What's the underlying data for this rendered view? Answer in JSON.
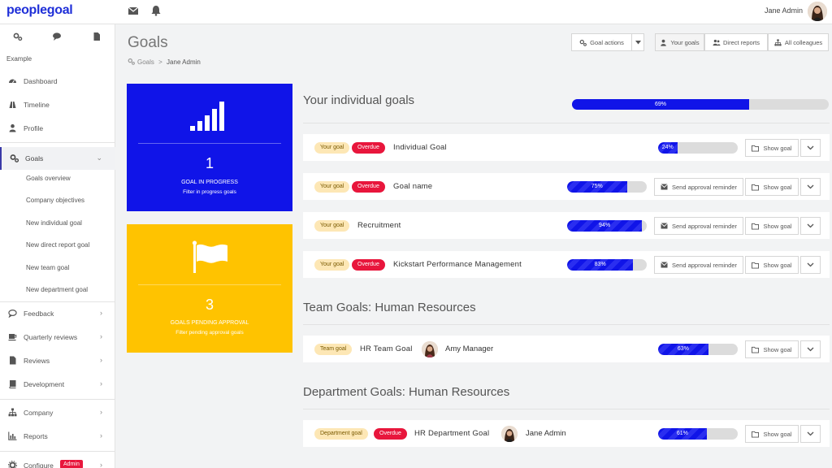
{
  "app": {
    "logo_text": "peoplegoal",
    "user_name": "Jane Admin"
  },
  "topbar": {
    "icons": [
      "mail-icon",
      "bell-icon"
    ]
  },
  "sidebar": {
    "tools": [
      "settings-icon",
      "chat-icon",
      "document-icon"
    ],
    "section_label": "Example",
    "items": {
      "dashboard": "Dashboard",
      "timeline": "Timeline",
      "profile": "Profile",
      "goals": "Goals",
      "feedback": "Feedback",
      "quarterly_reviews": "Quarterly reviews",
      "reviews": "Reviews",
      "development": "Development",
      "company": "Company",
      "reports": "Reports",
      "configure": "Configure",
      "configure_badge": "Admin"
    },
    "goal_subitems": [
      "Goals overview",
      "Company objectives",
      "New individual goal",
      "New direct report goal",
      "New team goal",
      "New department goal"
    ]
  },
  "header": {
    "title": "Goals",
    "breadcrumb_root": "Goals",
    "breadcrumb_sep": ">",
    "breadcrumb_current": "Jane Admin",
    "goal_actions": "Goal actions",
    "tabs": {
      "your_goals": "Your goals",
      "direct_reports": "Direct reports",
      "all_colleagues": "All colleagues"
    }
  },
  "cards": {
    "in_progress": {
      "count": "1",
      "caption": "GOAL IN PROGRESS",
      "sub": "Filter in progress goals"
    },
    "pending": {
      "count": "3",
      "caption": "GOALS PENDING APPROVAL",
      "sub": "Filter pending approval goals"
    }
  },
  "individual": {
    "title": "Your individual goals",
    "overall_progress": 69,
    "overall_label": "69%",
    "goals": [
      {
        "tag": "Your goal",
        "overdue": "Overdue",
        "name": "Individual Goal",
        "progress": 24,
        "progress_label": "24%",
        "show": "Show goal"
      },
      {
        "tag": "Your goal",
        "overdue": "Overdue",
        "name": "Goal name",
        "progress": 75,
        "progress_label": "75%",
        "reminder": "Send approval reminder",
        "show": "Show goal"
      },
      {
        "tag": "Your goal",
        "name": "Recruitment",
        "progress": 94,
        "progress_label": "94%",
        "reminder": "Send approval reminder",
        "show": "Show goal"
      },
      {
        "tag": "Your goal",
        "overdue": "Overdue",
        "name": "Kickstart Performance Management",
        "progress": 83,
        "progress_label": "83%",
        "reminder": "Send approval reminder",
        "show": "Show goal"
      }
    ]
  },
  "team": {
    "title": "Team Goals: Human Resources",
    "goal": {
      "tag": "Team goal",
      "name": "HR Team Goal",
      "owner": "Amy Manager",
      "progress": 63,
      "progress_label": "63%",
      "show": "Show goal"
    }
  },
  "department": {
    "title": "Department Goals: Human Resources",
    "goal": {
      "tag": "Department goal",
      "overdue": "Overdue",
      "name": "HR Department Goal",
      "owner": "Jane Admin",
      "progress": 61,
      "progress_label": "61%",
      "show": "Show goal"
    }
  }
}
